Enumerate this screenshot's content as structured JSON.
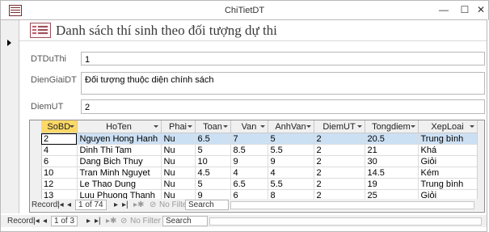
{
  "window": {
    "title": "ChiTietDT",
    "minimize": "—",
    "maximize": "☐",
    "close": "✕"
  },
  "form": {
    "title": "Danh sách thí sinh theo đối tượng dự thi",
    "fields": {
      "dtduthi_label": "DTDuThi",
      "dtduthi_value": "1",
      "diengiai_label": "DienGiaiDT",
      "diengiai_value": "Đối tượng thuộc diện chính sách",
      "diemut_label": "DiemUT",
      "diemut_value": "2"
    }
  },
  "subform": {
    "columns": [
      "SoBD",
      "HoTen",
      "Phai",
      "Toan",
      "Van",
      "AnhVan",
      "DiemUT",
      "Tongdiem",
      "XepLoai"
    ],
    "rows": [
      [
        "2",
        "Nguyen Hong Hanh",
        "Nu",
        "6.5",
        "7",
        "5",
        "2",
        "20.5",
        "Trung bình"
      ],
      [
        "4",
        "Dinh Thi Tam",
        "Nu",
        "5",
        "8.5",
        "5.5",
        "2",
        "21",
        "Khá"
      ],
      [
        "6",
        "Dang Bich Thuy",
        "Nu",
        "10",
        "9",
        "9",
        "2",
        "30",
        "Giỏi"
      ],
      [
        "10",
        "Tran Minh Nguyet",
        "Nu",
        "4.5",
        "4",
        "4",
        "2",
        "14.5",
        "Kém"
      ],
      [
        "12",
        "Le Thao Dung",
        "Nu",
        "5",
        "6.5",
        "5.5",
        "2",
        "19",
        "Trung bình"
      ],
      [
        "13",
        "Luu Phuong Thanh",
        "Nu",
        "9",
        "6",
        "8",
        "2",
        "25",
        "Giỏi"
      ]
    ],
    "nav": {
      "record_label": "Record:",
      "position": "1 of 74",
      "filter": "No Filter",
      "search": "Search"
    }
  },
  "main_nav": {
    "record_label": "Record:",
    "position": "1 of 3",
    "filter": "No Filter",
    "search": "Search"
  }
}
